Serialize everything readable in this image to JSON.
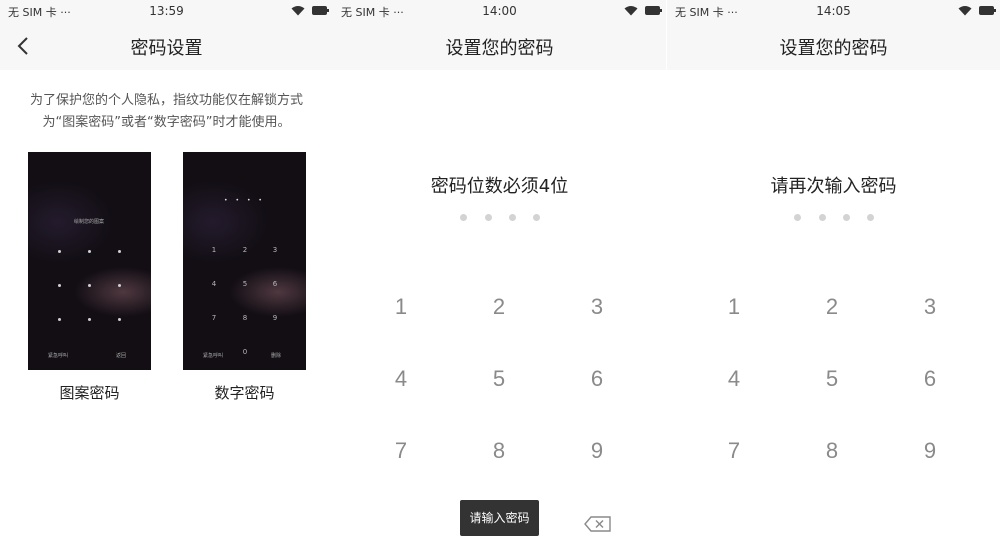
{
  "panel1": {
    "status": {
      "carrier": "无 SIM 卡 ···",
      "time": "13:59"
    },
    "nav": {
      "title": "密码设置",
      "back_icon": "chevron-left-icon"
    },
    "description": "为了保护您的个人隐私，指纹功能仅在解锁方式为“图案密码”或者“数字密码”时才能使用。",
    "options": [
      {
        "label": "图案密码",
        "preview_hint": "绘制您的图案",
        "left": "紧急呼叫",
        "right": "返回"
      },
      {
        "label": "数字密码",
        "dots": "• • • •",
        "keys": [
          "1",
          "2",
          "3",
          "4",
          "5",
          "6",
          "7",
          "8",
          "9",
          "0"
        ],
        "left": "紧急呼叫",
        "right": "删除"
      }
    ]
  },
  "panel2": {
    "status": {
      "carrier": "无 SIM 卡 ···",
      "time": "14:00"
    },
    "nav": {
      "title": "设置您的密码"
    },
    "prompt": "密码位数必须4位",
    "keypad": [
      "1",
      "2",
      "3",
      "4",
      "5",
      "6",
      "7",
      "8",
      "9"
    ],
    "toast": "请输入密码",
    "delete_icon": "backspace-icon"
  },
  "panel3": {
    "status": {
      "carrier": "无 SIM 卡 ···",
      "time": "14:05"
    },
    "nav": {
      "title": "设置您的密码"
    },
    "prompt": "请再次输入密码",
    "keypad": [
      "1",
      "2",
      "3",
      "4",
      "5",
      "6",
      "7",
      "8",
      "9"
    ]
  },
  "colors": {
    "navbar": "#f7f7f7",
    "key": "#8a8a8a",
    "dot": "#d3d3d3",
    "toast": "#333333"
  }
}
